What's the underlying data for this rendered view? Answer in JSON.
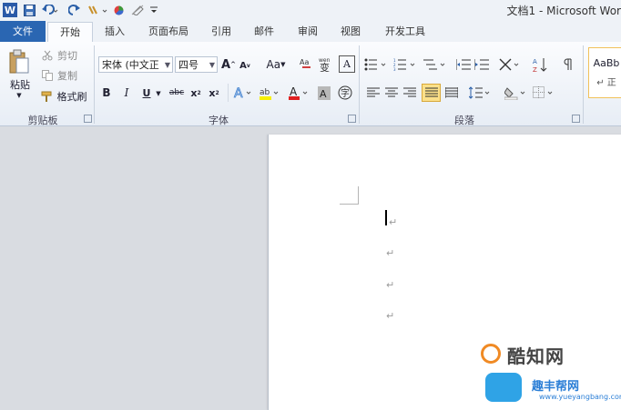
{
  "window": {
    "title": "文档1 - Microsoft Wor"
  },
  "quick_access": {
    "word_icon": "W",
    "save_icon": "save-icon",
    "undo_icon": "undo-icon",
    "redo_icon": "redo-icon",
    "customize_icon": "customize-icon"
  },
  "tabs": [
    "文件",
    "开始",
    "插入",
    "页面布局",
    "引用",
    "邮件",
    "审阅",
    "视图",
    "开发工具"
  ],
  "clipboard": {
    "paste": "粘贴",
    "cut": "剪切",
    "copy": "复制",
    "format_painter": "格式刷",
    "label": "剪贴板"
  },
  "font": {
    "name": "宋体 (中文正文)",
    "name_display": "宋体 (中文正",
    "size": "四号",
    "grow": "A",
    "shrink": "A",
    "change_case": "Aa",
    "bold": "B",
    "italic": "I",
    "underline": "U",
    "strike": "abc",
    "subscript": "x",
    "superscript": "x",
    "label": "字体"
  },
  "paragraph": {
    "label": "段落"
  },
  "styles": {
    "preview": "AaBb",
    "name": "正"
  },
  "document": {
    "paragraph_mark": "↵"
  },
  "watermark": {
    "brand": "酷知网",
    "brand2": "趣丰帮网",
    "url": "www.yueyangbang.com"
  },
  "colors": {
    "file_tab": "#2a66b2",
    "accent": "#f08a24"
  }
}
